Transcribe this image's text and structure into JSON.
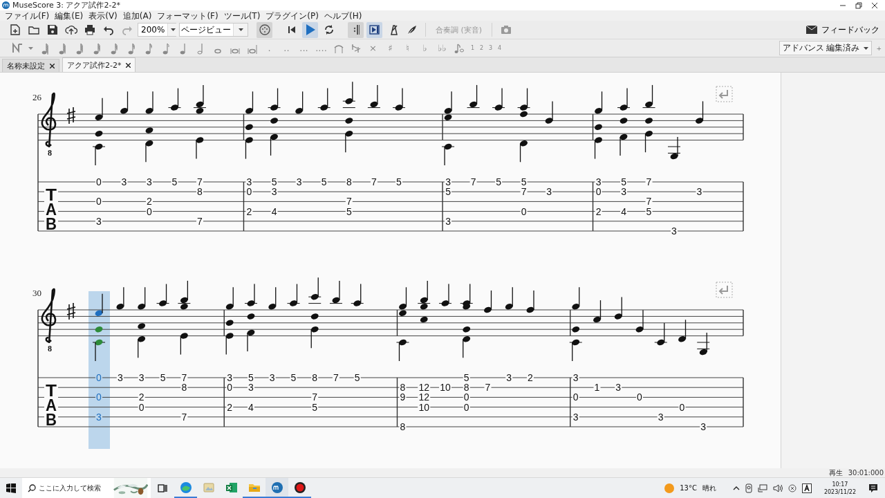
{
  "window": {
    "title": "MuseScore 3: アクア試作2-2*"
  },
  "menu": [
    "ファイル(F)",
    "編集(E)",
    "表示(V)",
    "追加(A)",
    "フォーマット(F)",
    "ツール(T)",
    "プラグイン(P)",
    "ヘルプ(H)"
  ],
  "toolbar": {
    "zoom": "200%",
    "view": "ページビュー",
    "playback": [
      {
        "kind": "midi",
        "on": true
      },
      {
        "kind": "rewind",
        "on": false
      },
      {
        "kind": "play",
        "on": true
      },
      {
        "kind": "loop",
        "on": false
      },
      {
        "kind": "repeat",
        "on": true
      },
      {
        "kind": "pan",
        "on": true
      },
      {
        "kind": "metronome",
        "on": false
      },
      {
        "kind": "feather",
        "on": false
      }
    ],
    "concert_pitch": {
      "label": "合奏調 (実音)",
      "disabled": true
    },
    "feedback": "フィードバック"
  },
  "palette": {
    "dots": [
      ".",
      "..",
      "...",
      "...."
    ],
    "accidentals": [
      "×",
      "♯",
      "♮",
      "♭",
      "♭♭"
    ],
    "voices": [
      "1",
      "2",
      "3",
      "4"
    ],
    "workspace": "アドバンス 編集済み",
    "add_workspace": "+"
  },
  "tabs": [
    {
      "label": "名称未設定",
      "selected": false
    },
    {
      "label": "アクア試作2-2*",
      "selected": true
    }
  ],
  "score": {
    "systems": [
      {
        "measure_number": "26",
        "clef_octave": "8",
        "tab_label": "TAB",
        "measures": [
          {
            "beats": [
              {
                "frets": {
                  "1": "0",
                  "3": "0",
                  "5": "3"
                },
                "selected": false
              },
              {
                "frets": {
                  "1": "3"
                },
                "selected": false
              },
              {
                "frets": {
                  "1": "3",
                  "3": "2",
                  "4": "0"
                },
                "selected": false
              },
              {
                "frets": {
                  "1": "5"
                },
                "selected": false
              },
              {
                "frets": {
                  "1": "7",
                  "2": "8",
                  "5": "7"
                },
                "selected": false
              }
            ]
          },
          {
            "beats": [
              {
                "frets": {
                  "1": "3",
                  "2": "0",
                  "4": "2"
                },
                "selected": false
              },
              {
                "frets": {
                  "1": "5",
                  "2": "3",
                  "4": "4"
                },
                "selected": false
              },
              {
                "frets": {
                  "1": "3"
                },
                "selected": false
              },
              {
                "frets": {
                  "1": "5"
                },
                "selected": false
              },
              {
                "frets": {
                  "1": "8",
                  "3": "7",
                  "4": "5"
                },
                "selected": false
              },
              {
                "frets": {
                  "1": "7"
                },
                "selected": false
              },
              {
                "frets": {
                  "1": "5"
                },
                "selected": false
              }
            ]
          },
          {
            "beats": [
              {
                "frets": {
                  "1": "3",
                  "2": "5",
                  "5": "3"
                },
                "selected": false
              },
              {
                "frets": {
                  "1": "7"
                },
                "selected": false
              },
              {
                "frets": {
                  "1": "5"
                },
                "selected": false
              },
              {
                "frets": {
                  "1": "5",
                  "2": "7",
                  "4": "0"
                },
                "selected": false
              },
              {
                "frets": {
                  "2": "3"
                },
                "selected": false
              }
            ]
          },
          {
            "beats": [
              {
                "frets": {
                  "1": "3",
                  "2": "0",
                  "4": "2"
                },
                "selected": false
              },
              {
                "frets": {
                  "1": "5",
                  "2": "3",
                  "4": "4"
                },
                "selected": false
              },
              {
                "frets": {
                  "1": "7",
                  "3": "7",
                  "4": "5"
                },
                "selected": false
              },
              {
                "frets": {
                  "6": "3"
                },
                "selected": false
              },
              {
                "frets": {
                  "2": "3"
                },
                "selected": false
              }
            ]
          }
        ]
      },
      {
        "measure_number": "30",
        "clef_octave": "8",
        "tab_label": "TAB",
        "measures": [
          {
            "beats": [
              {
                "frets": {
                  "1": "0",
                  "3": "0",
                  "5": "3"
                },
                "selected": true
              },
              {
                "frets": {
                  "1": "3"
                },
                "selected": false
              },
              {
                "frets": {
                  "1": "3",
                  "3": "2",
                  "4": "0"
                },
                "selected": false
              },
              {
                "frets": {
                  "1": "5"
                },
                "selected": false
              },
              {
                "frets": {
                  "1": "7",
                  "2": "8",
                  "5": "7"
                },
                "selected": false
              }
            ]
          },
          {
            "beats": [
              {
                "frets": {
                  "1": "3",
                  "2": "0",
                  "4": "2"
                },
                "selected": false
              },
              {
                "frets": {
                  "1": "5",
                  "2": "3",
                  "4": "4"
                },
                "selected": false
              },
              {
                "frets": {
                  "1": "3"
                },
                "selected": false
              },
              {
                "frets": {
                  "1": "5"
                },
                "selected": false
              },
              {
                "frets": {
                  "1": "8",
                  "3": "7",
                  "4": "5"
                },
                "selected": false
              },
              {
                "frets": {
                  "1": "7"
                },
                "selected": false
              },
              {
                "frets": {
                  "1": "5"
                },
                "selected": false
              }
            ]
          },
          {
            "beats": [
              {
                "frets": {
                  "2": "8",
                  "3": "9",
                  "6": "8"
                },
                "selected": false
              },
              {
                "frets": {
                  "2": "12",
                  "3": "12",
                  "4": "10"
                },
                "selected": false
              },
              {
                "frets": {
                  "2": "10"
                },
                "selected": false
              },
              {
                "frets": {
                  "1": "5",
                  "2": "8",
                  "3": "0",
                  "4": "0"
                },
                "selected": false
              },
              {
                "frets": {
                  "2": "7"
                },
                "selected": false
              },
              {
                "frets": {
                  "1": "3"
                },
                "selected": false
              },
              {
                "frets": {
                  "1": "2"
                },
                "selected": false
              }
            ]
          },
          {
            "beats": [
              {
                "frets": {
                  "1": "3",
                  "3": "0",
                  "5": "3"
                },
                "selected": false
              },
              {
                "frets": {
                  "2": "1"
                },
                "selected": false
              },
              {
                "frets": {
                  "2": "3"
                },
                "selected": false
              },
              {
                "frets": {
                  "3": "0"
                },
                "selected": false
              },
              {
                "frets": {
                  "5": "3"
                },
                "selected": false
              },
              {
                "frets": {
                  "4": "0"
                },
                "selected": false
              },
              {
                "frets": {
                  "6": "3"
                },
                "selected": false
              }
            ]
          }
        ]
      }
    ]
  },
  "status_bar": {
    "mode": "再生",
    "time": "30:01:000"
  },
  "taskbar": {
    "search_placeholder": "ここに入力して検索",
    "apps": [
      {
        "kind": "edge",
        "running": true,
        "active": false
      },
      {
        "kind": "photos",
        "running": false,
        "active": false
      },
      {
        "kind": "excel",
        "running": false,
        "active": false
      },
      {
        "kind": "folder",
        "running": true,
        "active": false
      },
      {
        "kind": "musescore",
        "running": true,
        "active": true
      },
      {
        "kind": "record",
        "running": true,
        "active": false
      }
    ],
    "temperature": "13°C",
    "weather": "晴れ",
    "time": "10:17",
    "date": "2023/11/22"
  }
}
